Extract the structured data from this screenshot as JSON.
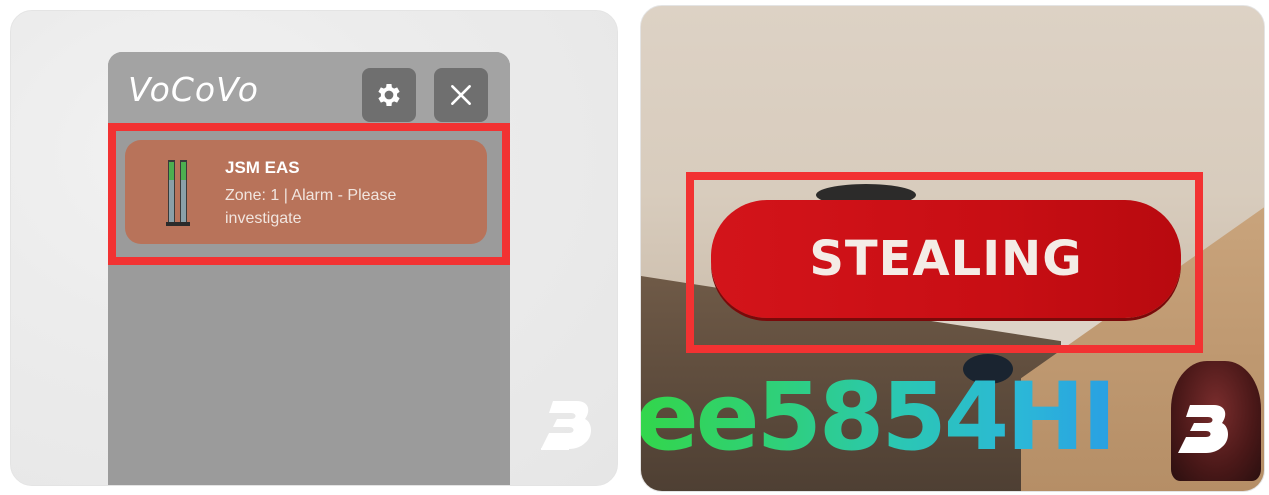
{
  "left_panel": {
    "widget": {
      "logo_text": "VoCoVo",
      "settings_icon": "gear-icon",
      "close_icon": "close-icon",
      "alert": {
        "title": "JSM EAS",
        "description": "Zone: 1 | Alarm - Please investigate",
        "icon": "security-gate-icon"
      }
    },
    "highlight_color": "#f23232",
    "watermark_icon": "brand-b-logo"
  },
  "right_panel": {
    "badge_text": "STEALING",
    "badge_color": "#d3141a",
    "player_name_visible": "ee5854HI",
    "highlight_color": "#f23232",
    "watermark_icon": "brand-b-logo"
  }
}
